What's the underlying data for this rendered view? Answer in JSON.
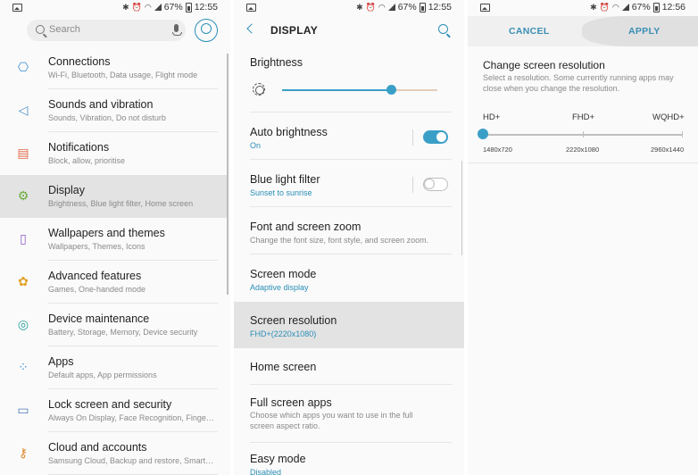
{
  "status_left": {
    "battery": "67%",
    "time": "12:55"
  },
  "status_mid": {
    "battery": "67%",
    "time": "12:55"
  },
  "status_right": {
    "battery": "67%",
    "time": "12:56"
  },
  "settings": {
    "search_placeholder": "Search",
    "items": [
      {
        "title": "Connections",
        "subtitle": "Wi-Fi, Bluetooth, Data usage, Flight mode",
        "icon": "connections-icon",
        "color": "#3a8fd6"
      },
      {
        "title": "Sounds and vibration",
        "subtitle": "Sounds, Vibration, Do not disturb",
        "icon": "sound-icon",
        "color": "#4a8fc4"
      },
      {
        "title": "Notifications",
        "subtitle": "Block, allow, prioritise",
        "icon": "notifications-icon",
        "color": "#e06a4a"
      },
      {
        "title": "Display",
        "subtitle": "Brightness, Blue light filter, Home screen",
        "icon": "display-icon",
        "color": "#6aaa3a"
      },
      {
        "title": "Wallpapers and themes",
        "subtitle": "Wallpapers, Themes, Icons",
        "icon": "wallpaper-icon",
        "color": "#8a5ac4"
      },
      {
        "title": "Advanced features",
        "subtitle": "Games, One-handed mode",
        "icon": "advanced-features-icon",
        "color": "#e0a020"
      },
      {
        "title": "Device maintenance",
        "subtitle": "Battery, Storage, Memory, Device security",
        "icon": "maintenance-icon",
        "color": "#2aa0a0"
      },
      {
        "title": "Apps",
        "subtitle": "Default apps, App permissions",
        "icon": "apps-icon",
        "color": "#3a8fd6"
      },
      {
        "title": "Lock screen and security",
        "subtitle": "Always On Display, Face Recognition, Finge…",
        "icon": "lock-icon",
        "color": "#4a7ab4"
      },
      {
        "title": "Cloud and accounts",
        "subtitle": "Samsung Cloud, Backup and restore, Smart…",
        "icon": "key-icon",
        "color": "#e08a30"
      }
    ]
  },
  "display": {
    "title": "DISPLAY",
    "brightness_label": "Brightness",
    "brightness_level": 0.7,
    "auto_brightness": {
      "title": "Auto brightness",
      "subtitle": "On"
    },
    "blue_light": {
      "title": "Blue light filter",
      "subtitle": "Sunset to sunrise"
    },
    "font_zoom": {
      "title": "Font and screen zoom",
      "subtitle": "Change the font size, font style, and screen zoom."
    },
    "screen_mode": {
      "title": "Screen mode",
      "subtitle": "Adaptive display"
    },
    "screen_resolution": {
      "title": "Screen resolution",
      "subtitle": "FHD+(2220x1080)"
    },
    "home_screen": {
      "title": "Home screen"
    },
    "full_screen_apps": {
      "title": "Full screen apps",
      "subtitle": "Choose which apps you want to use in the full screen aspect ratio."
    },
    "easy_mode": {
      "title": "Easy mode",
      "subtitle": "Disabled"
    }
  },
  "resolution": {
    "cancel": "CANCEL",
    "apply": "APPLY",
    "title": "Change screen resolution",
    "description": "Select a resolution. Some currently running apps may close when you change the resolution.",
    "levels": [
      "HD+",
      "FHD+",
      "WQHD+"
    ],
    "values": [
      "1480x720",
      "2220x1080",
      "2960x1440"
    ],
    "selected_index": 0
  },
  "colors": {
    "accent": "#3a9fc7"
  }
}
